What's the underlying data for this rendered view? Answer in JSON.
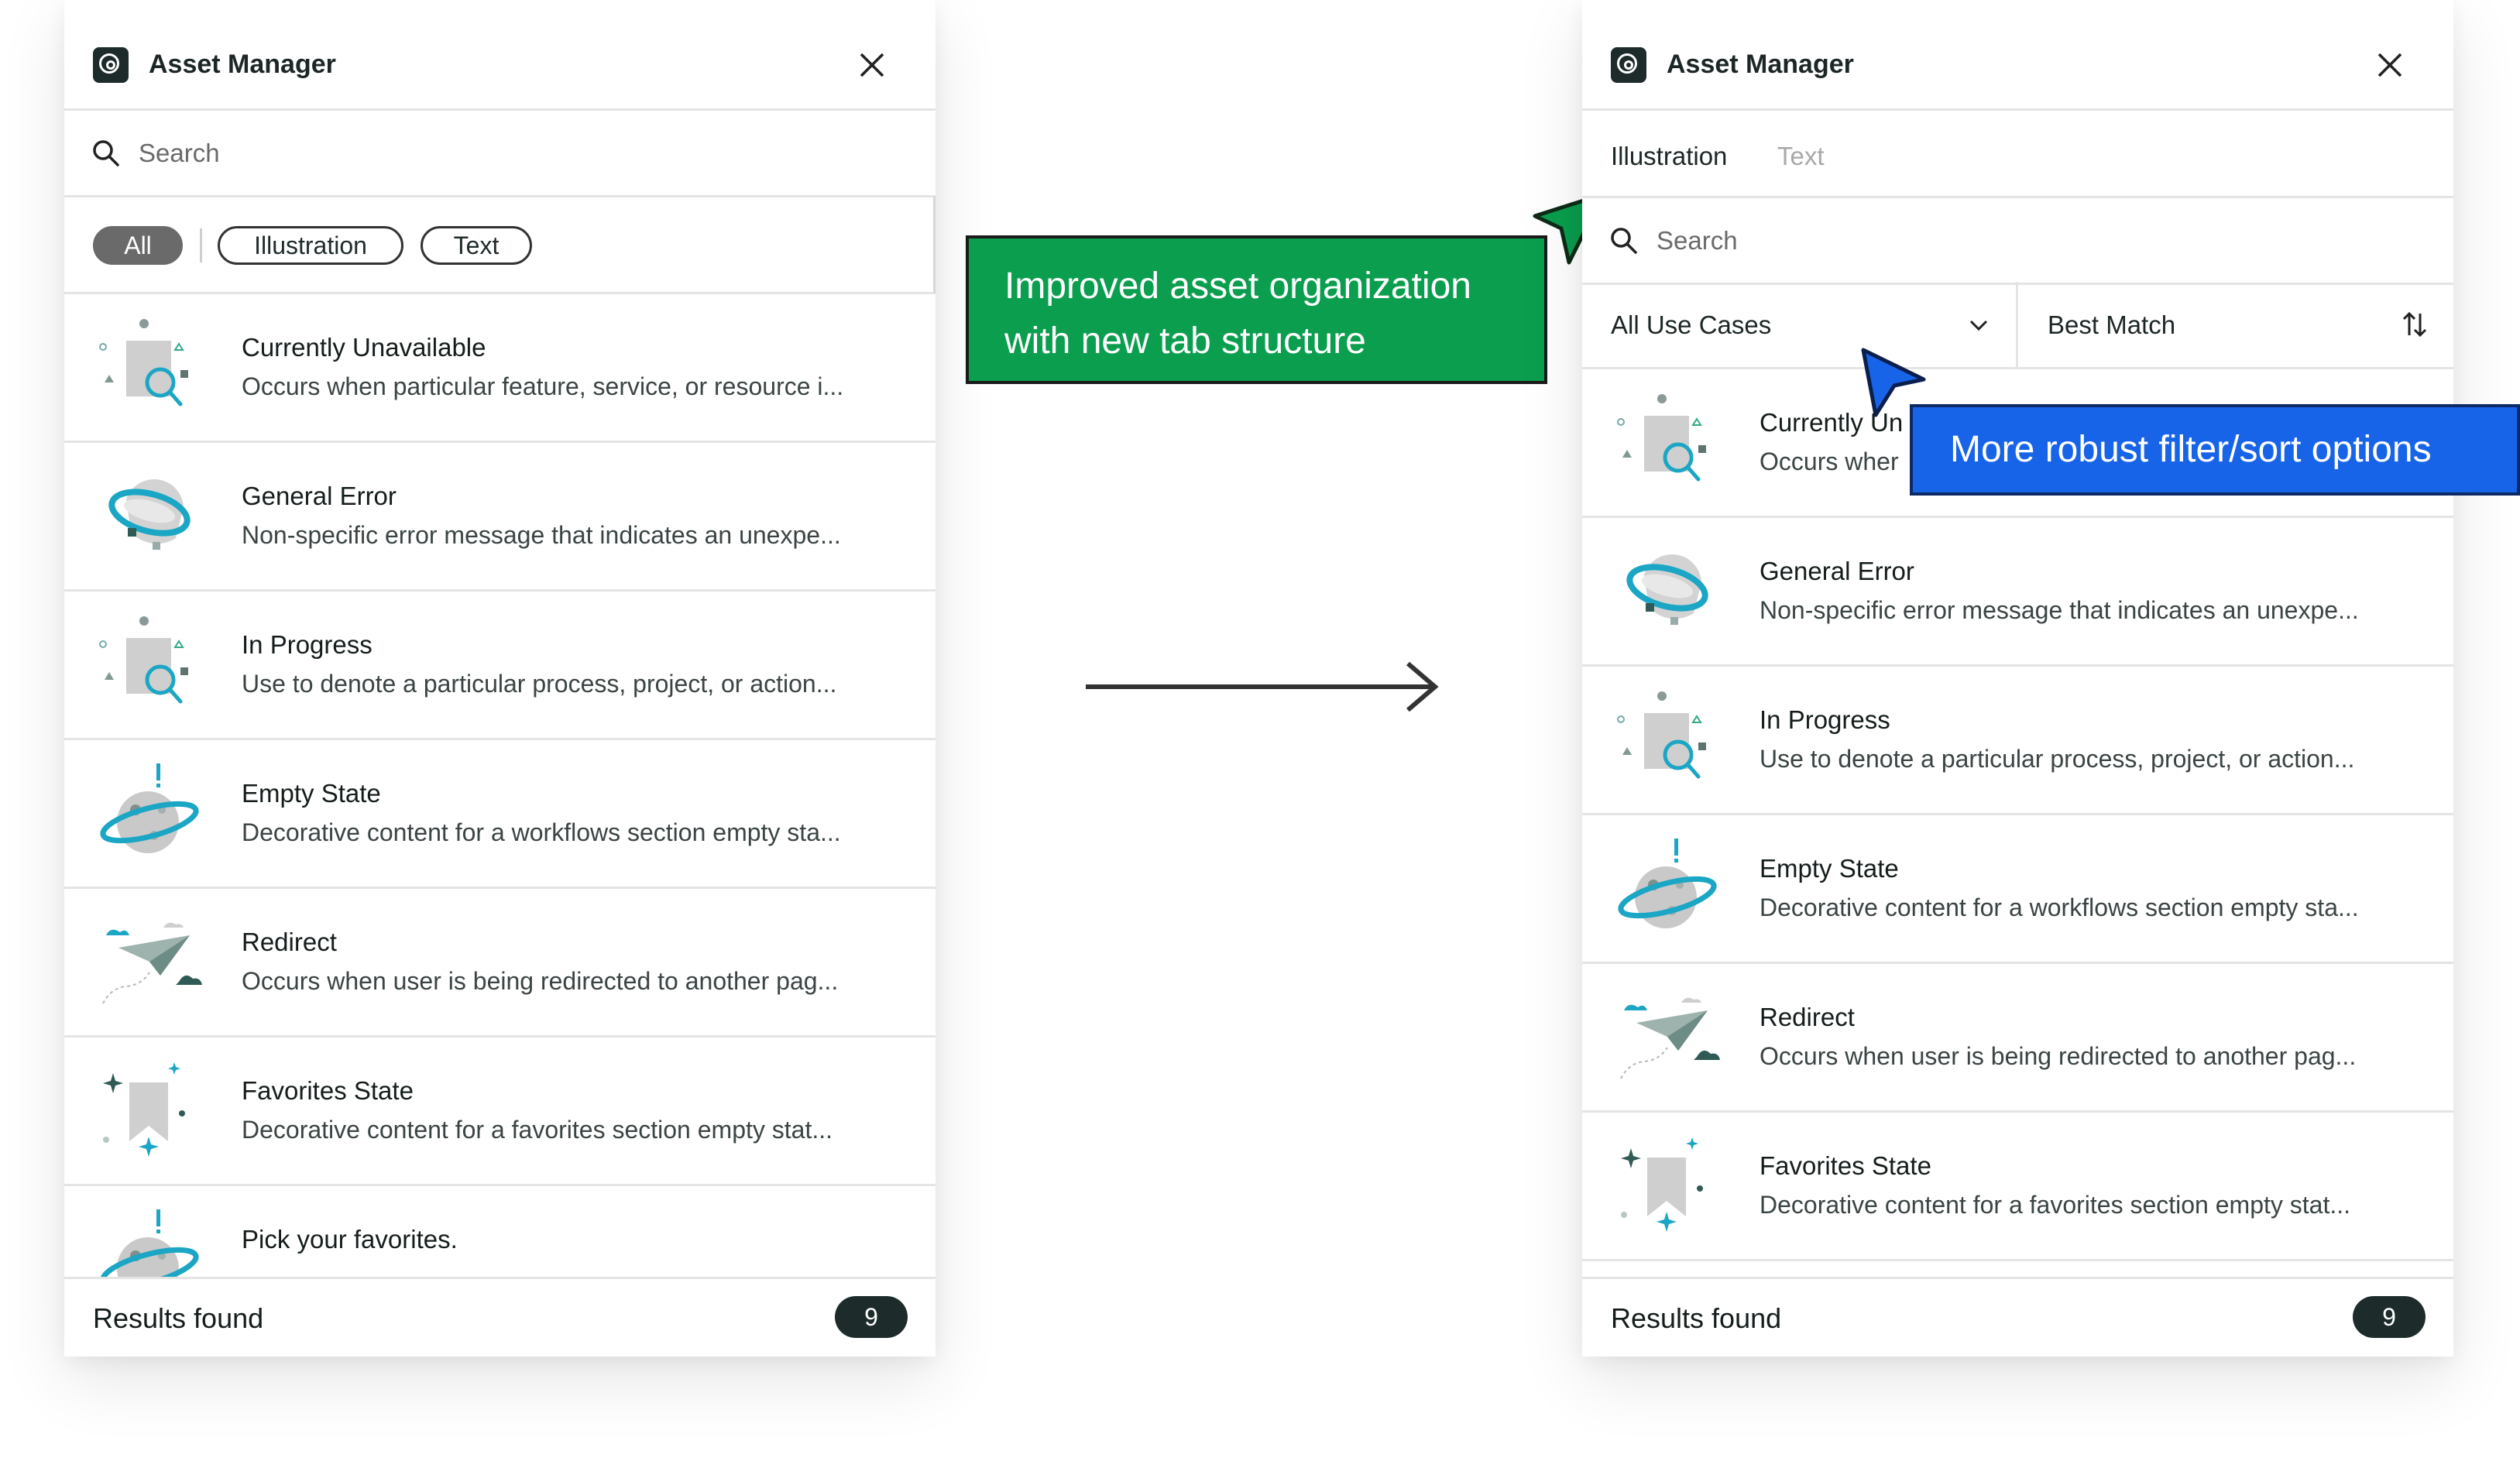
{
  "colors": {
    "accent_dark": "#1d2b2b",
    "green_callout": "#0a9e4e",
    "blue_callout": "#1764e8",
    "illustration_teal": "#1aa6c4"
  },
  "left_panel": {
    "title": "Asset Manager",
    "search_placeholder": "Search",
    "chips": [
      "All",
      "Illustration",
      "Text"
    ],
    "items": [
      {
        "title": "Currently Unavailable",
        "desc": "Occurs when particular feature, service, or resource i...",
        "icon": "magnifier-illustration"
      },
      {
        "title": "General Error",
        "desc": "Non-specific error message that indicates an unexpe...",
        "icon": "ringed-planet-illustration"
      },
      {
        "title": "In Progress",
        "desc": "Use to denote a particular process, project, or action...",
        "icon": "magnifier-illustration"
      },
      {
        "title": "Empty State",
        "desc": "Decorative content for a workflows section empty sta...",
        "icon": "planet-alert-illustration"
      },
      {
        "title": "Redirect",
        "desc": "Occurs when user is being redirected to another pag...",
        "icon": "paper-plane-illustration"
      },
      {
        "title": "Favorites State",
        "desc": "Decorative content for a favorites section empty stat...",
        "icon": "bookmark-illustration"
      },
      {
        "title": "Pick your favorites.",
        "desc": "",
        "icon": "planet-alert-illustration"
      }
    ],
    "results_label": "Results found",
    "results_count": "9"
  },
  "right_panel": {
    "title": "Asset Manager",
    "tabs": [
      "Illustration",
      "Text"
    ],
    "search_placeholder": "Search",
    "filter_label": "All Use Cases",
    "sort_label": "Best Match",
    "items": [
      {
        "title": "Currently Un",
        "desc": "Occurs wher",
        "icon": "magnifier-illustration"
      },
      {
        "title": "General Error",
        "desc": "Non-specific error message that indicates an unexpe...",
        "icon": "ringed-planet-illustration"
      },
      {
        "title": "In Progress",
        "desc": "Use to denote a particular process, project, or action...",
        "icon": "magnifier-illustration"
      },
      {
        "title": "Empty State",
        "desc": "Decorative content for a workflows section empty sta...",
        "icon": "planet-alert-illustration"
      },
      {
        "title": "Redirect",
        "desc": "Occurs when user is being redirected to another pag...",
        "icon": "paper-plane-illustration"
      },
      {
        "title": "Favorites State",
        "desc": "Decorative content for a favorites section empty stat...",
        "icon": "bookmark-illustration"
      }
    ],
    "results_label": "Results found",
    "results_count": "9"
  },
  "callouts": {
    "green": [
      "Improved asset organization",
      "with new tab structure"
    ],
    "blue": "More robust filter/sort options"
  }
}
